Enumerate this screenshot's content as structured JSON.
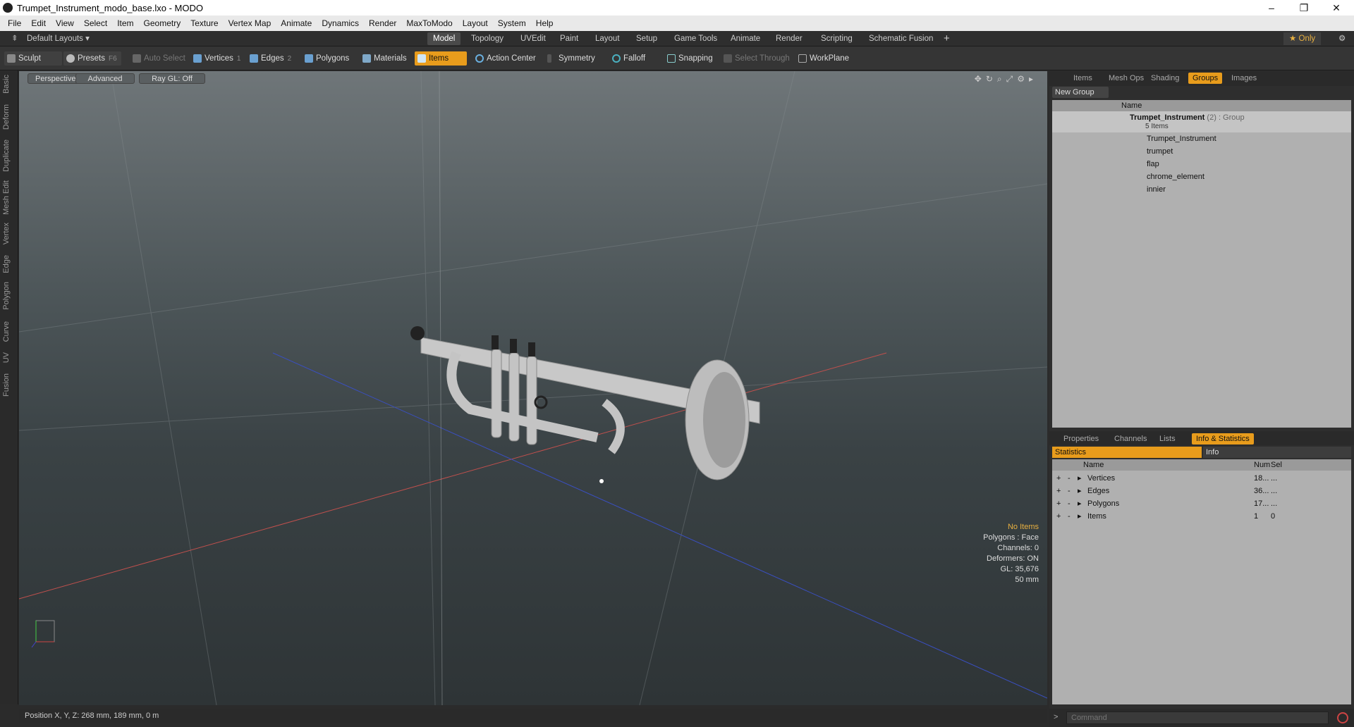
{
  "window": {
    "title": "Trumpet_Instrument_modo_base.lxo - MODO",
    "minimize": "–",
    "maximize": "❐",
    "close": "✕"
  },
  "menu": [
    "File",
    "Edit",
    "View",
    "Select",
    "Item",
    "Geometry",
    "Texture",
    "Vertex Map",
    "Animate",
    "Dynamics",
    "Render",
    "MaxToModo",
    "Layout",
    "System",
    "Help"
  ],
  "layout": {
    "default": "Default Layouts ▾",
    "tabs": [
      "Model",
      "Topology",
      "UVEdit",
      "Paint",
      "Layout",
      "Setup",
      "Game Tools",
      "Animate",
      "Render",
      "Scripting",
      "Schematic Fusion"
    ],
    "active": "Model",
    "add": "+",
    "only": "★ Only",
    "gear": "⚙"
  },
  "toolbar": {
    "sculpt": "Sculpt",
    "presets": "Presets",
    "presets_key": "F6",
    "auto_select": "Auto Select",
    "vertices": "Vertices",
    "vertices_key": "1",
    "edges": "Edges",
    "edges_key": "2",
    "polygons": "Polygons",
    "materials": "Materials",
    "items": "Items",
    "action_center": "Action Center",
    "symmetry": "Symmetry",
    "falloff": "Falloff",
    "snapping": "Snapping",
    "select_through": "Select Through",
    "workplane": "WorkPlane"
  },
  "lefttabs": [
    "Basic",
    "Deform",
    "Duplicate",
    "Mesh Edit",
    "Vertex",
    "Edge",
    "Polygon",
    "Curve",
    "UV",
    "Fusion"
  ],
  "viewport": {
    "perspective": "Perspective",
    "advanced": "Advanced",
    "raygl": "Ray GL: Off",
    "info": [
      "No Items",
      "Polygons : Face",
      "Channels: 0",
      "Deformers: ON",
      "GL: 35,676",
      "50 mm"
    ]
  },
  "status": {
    "position": "Position X, Y, Z:   268 mm, 189 mm, 0 m"
  },
  "top_panel": {
    "tabs": [
      "Items",
      "Mesh Ops",
      "Shading",
      "Groups",
      "Images"
    ],
    "active": "Groups",
    "new_group": "New Group",
    "col_name": "Name",
    "group": {
      "name": "Trumpet_Instrument",
      "count": "(2)",
      "type": ": Group",
      "items_count": "5 Items"
    },
    "children": [
      "Trumpet_Instrument",
      "trumpet",
      "flap",
      "chrome_element",
      "innier"
    ]
  },
  "bottom_panel": {
    "tabs": [
      "Properties",
      "Channels",
      "Lists",
      "Info & Statistics"
    ],
    "active": "Info & Statistics",
    "sub_tabs": [
      "Statistics",
      "Info"
    ],
    "cols": [
      "Name",
      "Num",
      "Sel"
    ],
    "rows": [
      {
        "name": "Vertices",
        "num": "18...",
        "sel": "..."
      },
      {
        "name": "Edges",
        "num": "36...",
        "sel": "..."
      },
      {
        "name": "Polygons",
        "num": "17...",
        "sel": "..."
      },
      {
        "name": "Items",
        "num": "1",
        "sel": "0"
      }
    ]
  },
  "command": {
    "placeholder": "Command",
    "prompt": ">"
  }
}
